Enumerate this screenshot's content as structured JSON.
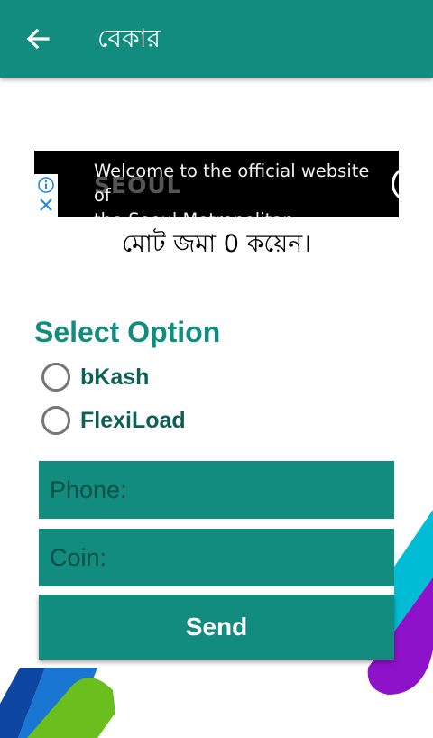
{
  "appbar": {
    "title": "বেকার",
    "back_icon": "arrow-left-icon",
    "background": "#128c7e"
  },
  "ad": {
    "headline": "Welcome to the official website of\nthe Seoul Metropolitan Government.",
    "logo_text": "SEOUL",
    "info_icon": "info-icon",
    "close_icon": "close-icon"
  },
  "balance_text": "মোট জমা 0 কয়েন।",
  "payment": {
    "section_title": "Select Option",
    "options": [
      {
        "label": "bKash",
        "selected": false
      },
      {
        "label": "FlexiLoad",
        "selected": false
      }
    ]
  },
  "form": {
    "phone_placeholder": "Phone:",
    "coin_placeholder": "Coin:",
    "send_label": "Send"
  },
  "colors": {
    "primary": "#128c7e",
    "decor_cyan": "#00bcd4",
    "decor_purple": "#8e12c9",
    "decor_blue": "#1565c0",
    "decor_green": "#6abf1e"
  }
}
